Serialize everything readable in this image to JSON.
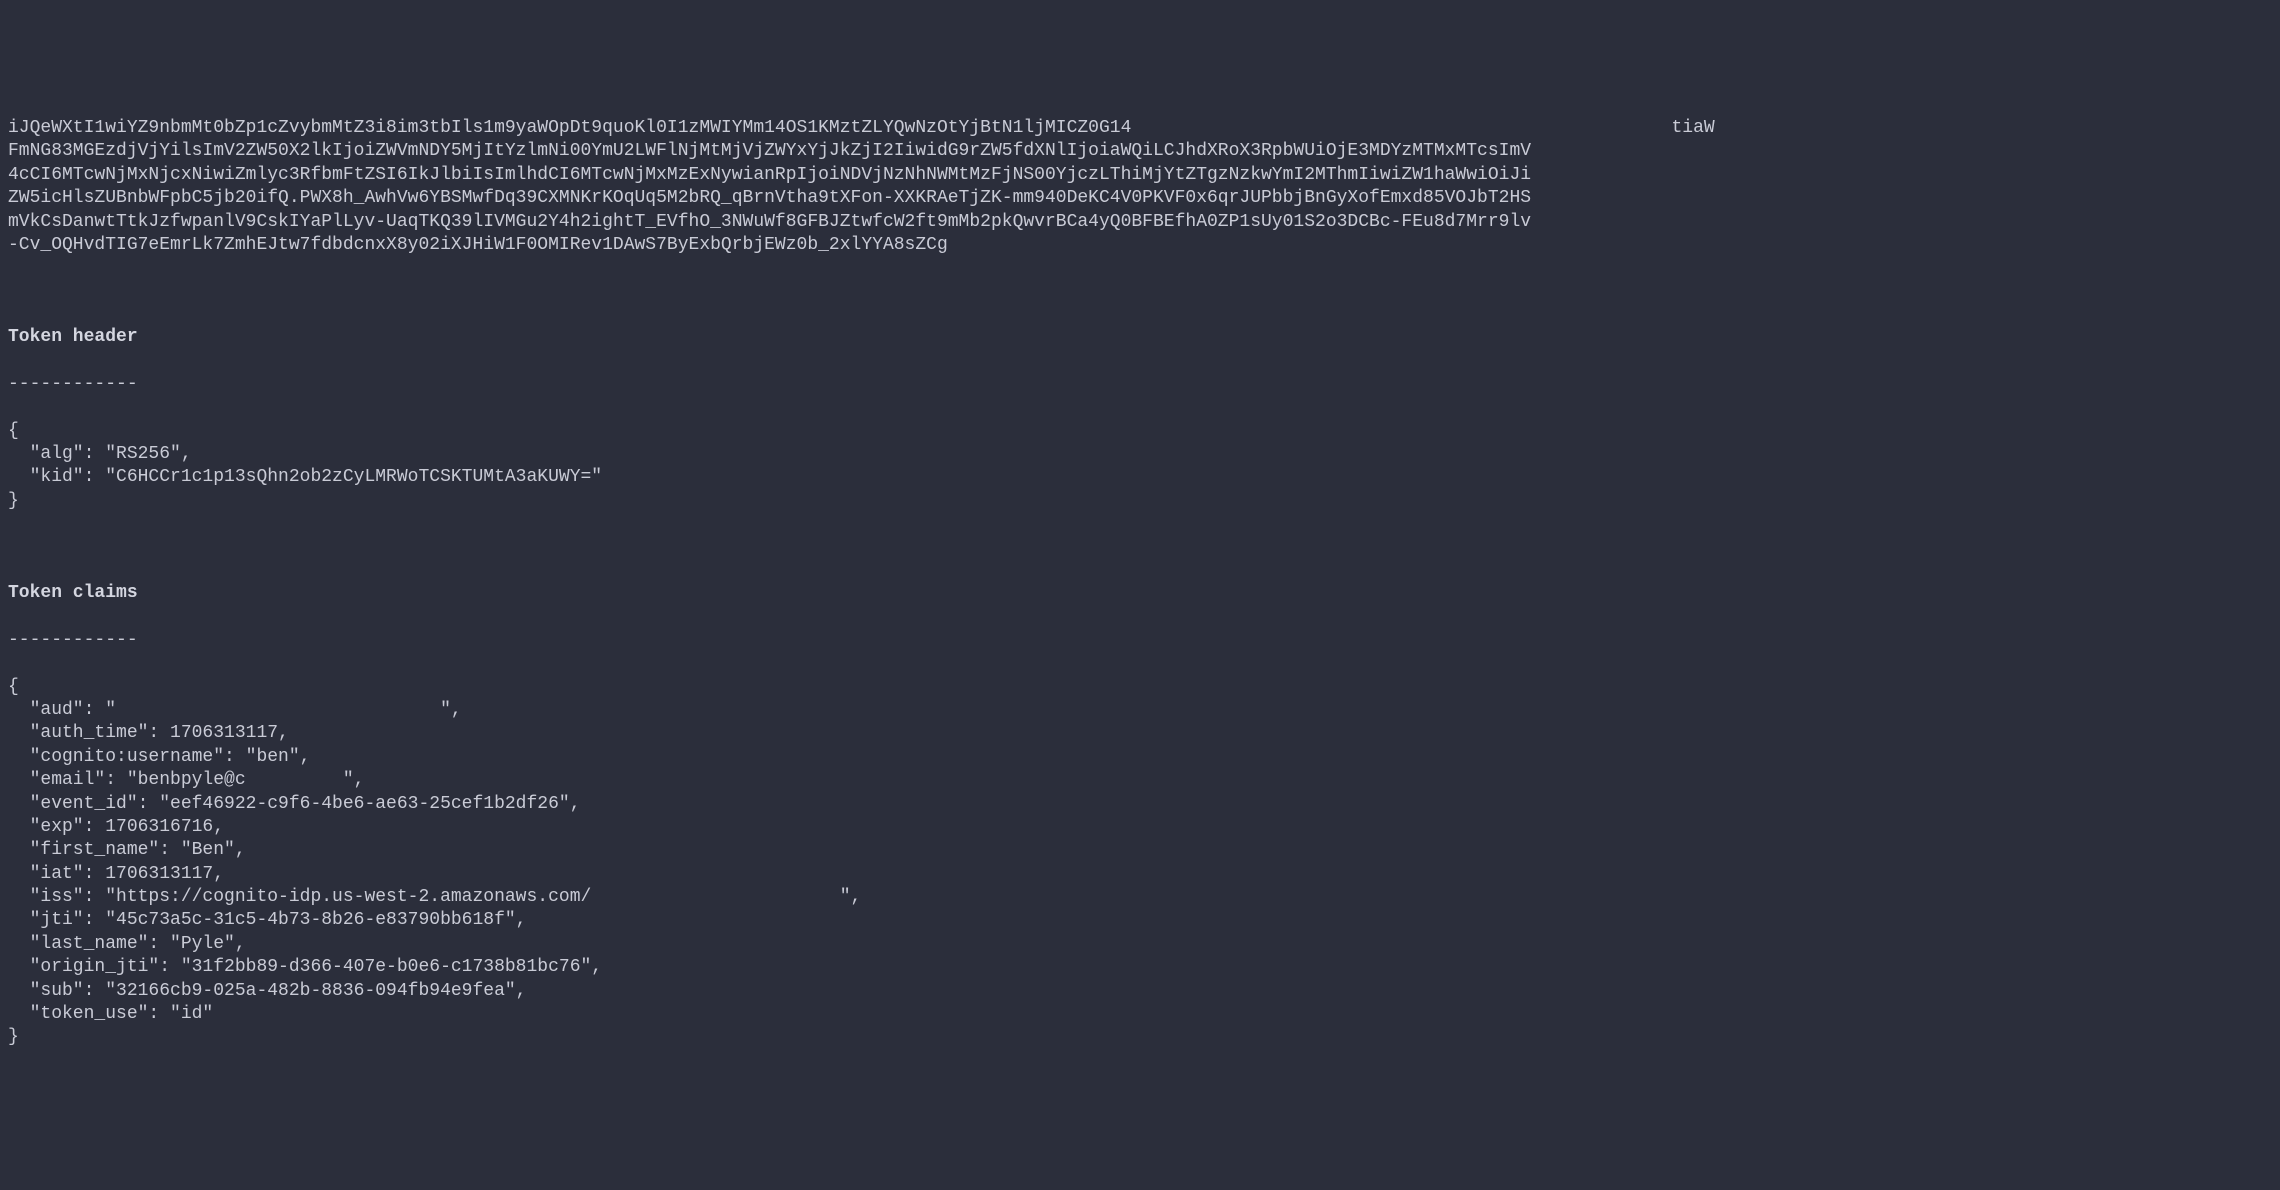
{
  "jwt_token": "iJQeWXtI1wiYZ9nbmMt0bZp1cZvybmMtZ3i8im3tbIls1m9yaWOpDt9quoKl0I1zMWIYMm14OS1KMztZLYQwNzOtYjBtN1ljMICZ0G14                                                  tiaW\nFmNG83MGEzdjVjYilsImV2ZW50X2lkIjoiZWVmNDY5MjItYzlmNi00YmU2LWFlNjMtMjVjZWYxYjJkZjI2IiwidG9rZW5fdXNlIjoiaWQiLCJhdXRoX3RpbWUiOjE3MDYzMTMxMTcsImV\n4cCI6MTcwNjMxNjcxNiwiZmlyc3RfbmFtZSI6IkJlbiIsImlhdCI6MTcwNjMxMzExNywianRpIjoiNDVjNzNhNWMtMzFjNS00YjczLThiMjYtZTgzNzkwYmI2MThmIiwiZW1haWwiOiJi\nZW5icHlsZUBnbWFpbC5jb20ifQ.PWX8h_AwhVw6YBSMwfDq39CXMNKrKOqUq5M2bRQ_qBrnVtha9tXFon-XXKRAeTjZK-mm940DeKC4V0PKVF0x6qrJUPbbjBnGyXofEmxd85VOJbT2HS\nmVkCsDanwtTtkJzfwpanlV9CskIYaPlLyv-UaqTKQ39lIVMGu2Y4h2ightT_EVfhO_3NWuWf8GFBJZtwfcW2ft9mMb2pkQwvrBCa4yQ0BFBEfhA0ZP1sUy01S2o3DCBc-FEu8d7Mrr9lv\n-Cv_OQHvdTIG7eEmrLk7ZmhEJtw7fdbdcnxX8y02iXJHiW1F0OMIRev1DAwS7ByExbQrbjEWz0b_2xlYYA8sZCg",
  "sections": {
    "header": {
      "title": "Token header",
      "separator": "------------",
      "json": "{\n  \"alg\": \"RS256\",\n  \"kid\": \"C6HCCr1c1p13sQhn2ob2zCyLMRWoTCSKTUMtA3aKUWY=\"\n}"
    },
    "claims": {
      "title": "Token claims",
      "separator": "------------",
      "json": "{\n  \"aud\": \"                              \",\n  \"auth_time\": 1706313117,\n  \"cognito:username\": \"ben\",\n  \"email\": \"benbpyle@c         \",\n  \"event_id\": \"eef46922-c9f6-4be6-ae63-25cef1b2df26\",\n  \"exp\": 1706316716,\n  \"first_name\": \"Ben\",\n  \"iat\": 1706313117,\n  \"iss\": \"https://cognito-idp.us-west-2.amazonaws.com/                       \",\n  \"jti\": \"45c73a5c-31c5-4b73-8b26-e83790bb618f\",\n  \"last_name\": \"Pyle\",\n  \"origin_jti\": \"31f2bb89-d366-407e-b0e6-c1738b81bc76\",\n  \"sub\": \"32166cb9-025a-482b-8836-094fb94e9fea\",\n  \"token_use\": \"id\"\n}"
    }
  }
}
